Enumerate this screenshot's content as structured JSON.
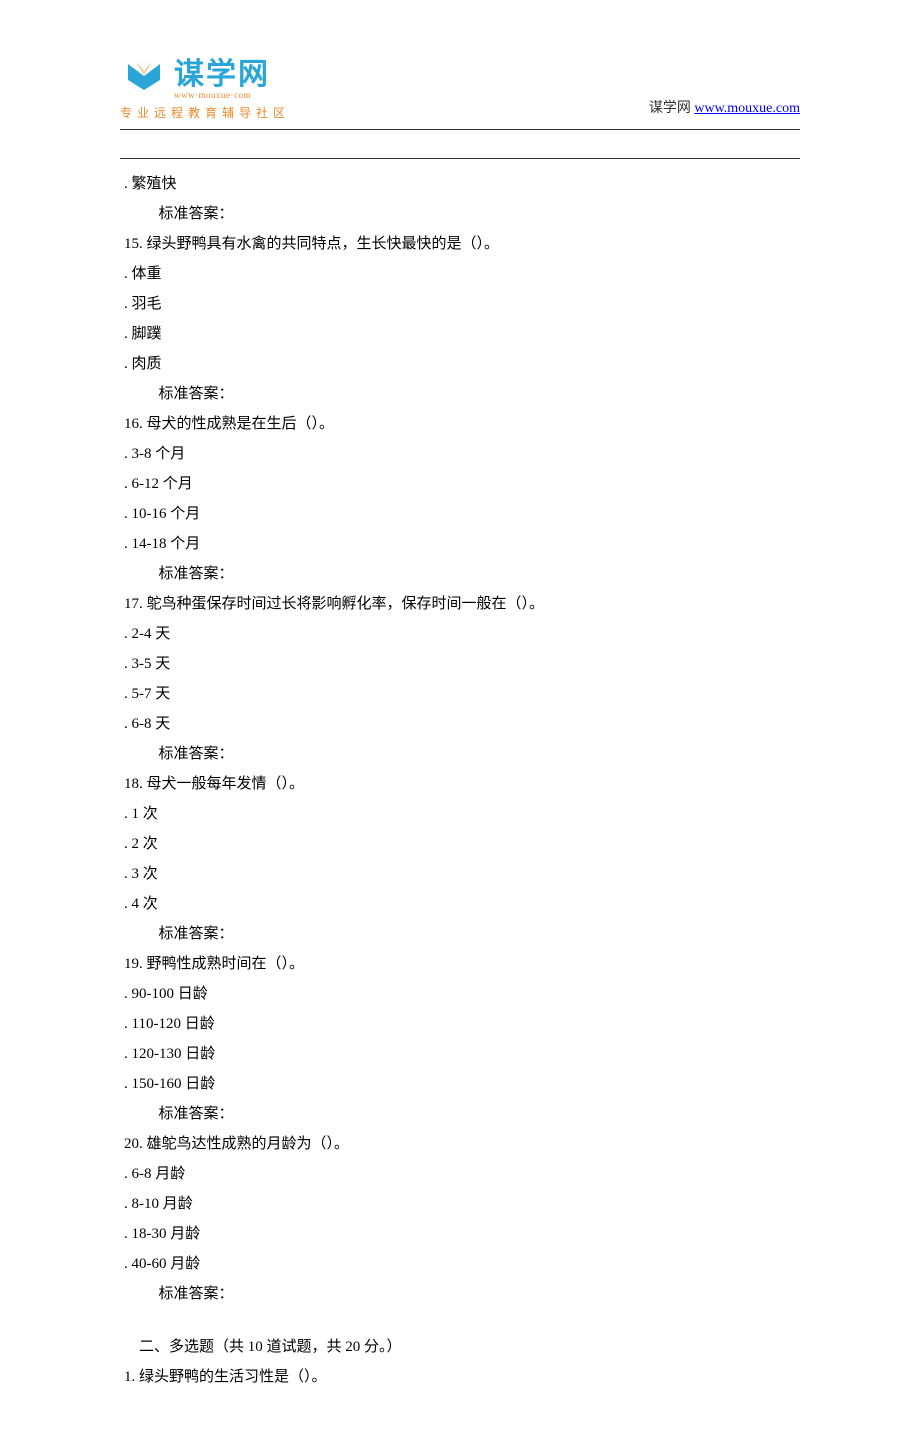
{
  "header": {
    "logo_main": "谋学网",
    "logo_sub": "www·mouxue·com",
    "logo_tagline": "专业远程教育辅导社区",
    "right_label": "谋学网",
    "right_url": "www.mouxue.com"
  },
  "body": {
    "pre": [
      {
        "type": "option",
        "text": "繁殖快"
      },
      {
        "type": "answer",
        "text": "标准答案："
      }
    ],
    "questions": [
      {
        "num": "15.",
        "stem": "绿头野鸭具有水禽的共同特点，生长快最快的是（）。",
        "options": [
          "体重",
          "羽毛",
          "脚蹼",
          "肉质"
        ],
        "answer": "标准答案："
      },
      {
        "num": "16.",
        "stem": "母犬的性成熟是在生后（）。",
        "options": [
          "3-8 个月",
          "6-12 个月",
          "10-16 个月",
          "14-18 个月"
        ],
        "answer": "标准答案："
      },
      {
        "num": "17.",
        "stem": "鸵鸟种蛋保存时间过长将影响孵化率，保存时间一般在（）。",
        "options": [
          "2-4 天",
          "3-5 天",
          "5-7 天",
          "6-8 天"
        ],
        "answer": "标准答案："
      },
      {
        "num": "18.",
        "stem": "母犬一般每年发情（）。",
        "options": [
          "1 次",
          "2 次",
          "3 次",
          "4 次"
        ],
        "answer": "标准答案："
      },
      {
        "num": "19.",
        "stem": "野鸭性成熟时间在（）。",
        "options": [
          "90-100 日龄",
          "110-120 日龄",
          "120-130 日龄",
          "150-160 日龄"
        ],
        "answer": "标准答案："
      },
      {
        "num": "20.",
        "stem": "雄鸵鸟达性成熟的月龄为（）。",
        "options": [
          "6-8 月龄",
          "8-10 月龄",
          "18-30 月龄",
          "40-60 月龄"
        ],
        "answer": "标准答案："
      }
    ],
    "section2": {
      "heading": "二、多选题（共 10 道试题，共 20 分。）",
      "q1_num": "1.",
      "q1_stem": "绿头野鸭的生活习性是（）。"
    }
  }
}
